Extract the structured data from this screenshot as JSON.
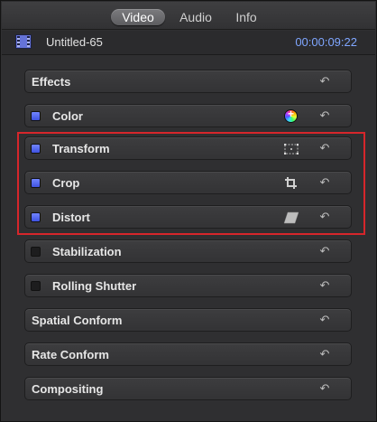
{
  "tabs": [
    {
      "label": "Video",
      "active": true
    },
    {
      "label": "Audio",
      "active": false
    },
    {
      "label": "Info",
      "active": false
    }
  ],
  "clip": {
    "title": "Untitled-65",
    "timecode": "00:00:09:22",
    "icon": "film-icon"
  },
  "rows": [
    {
      "label": "Effects",
      "checkbox": "none",
      "tool": "",
      "reset": "↶"
    },
    {
      "label": "Color",
      "checkbox": "on",
      "tool": "color-board-icon",
      "reset": "↶"
    },
    {
      "label": "Transform",
      "checkbox": "on",
      "tool": "transform-icon",
      "reset": "↶"
    },
    {
      "label": "Crop",
      "checkbox": "on",
      "tool": "crop-icon",
      "reset": "↶"
    },
    {
      "label": "Distort",
      "checkbox": "on",
      "tool": "distort-icon",
      "reset": "↶"
    },
    {
      "label": "Stabilization",
      "checkbox": "off",
      "tool": "",
      "reset": "↶"
    },
    {
      "label": "Rolling Shutter",
      "checkbox": "off",
      "tool": "",
      "reset": "↶"
    },
    {
      "label": "Spatial Conform",
      "checkbox": "none",
      "tool": "",
      "reset": "↶"
    },
    {
      "label": "Rate Conform",
      "checkbox": "none",
      "tool": "",
      "reset": "↶"
    },
    {
      "label": "Compositing",
      "checkbox": "none",
      "tool": "",
      "reset": "↶"
    }
  ],
  "colors": {
    "accent": "#4b5bff",
    "timecode": "#7fa6ff",
    "highlight": "#d6262b"
  }
}
